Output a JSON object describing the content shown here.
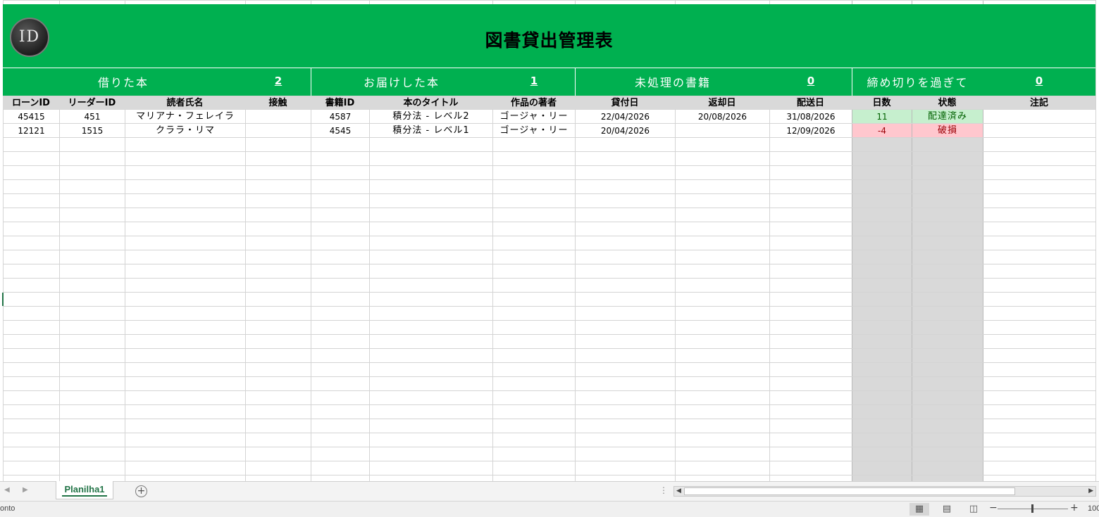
{
  "sheet": {
    "title": "図書貸出管理表",
    "logo_text": "ID",
    "stats": [
      {
        "label": "借りた本",
        "value": "2"
      },
      {
        "label": "お届けした本",
        "value": "1"
      },
      {
        "label": "未処理の書籍",
        "value": "0"
      },
      {
        "label": "締め切りを過ぎて",
        "value": "0"
      }
    ],
    "headers": [
      "ローンID",
      "リーダーID",
      "読者氏名",
      "接触",
      "書籍ID",
      "本のタイトル",
      "作品の著者",
      "貸付日",
      "返却日",
      "配送日",
      "日数",
      "状態",
      "注記"
    ],
    "rows": [
      {
        "loan_id": "45415",
        "reader_id": "451",
        "reader_name": "マリアナ・フェレイラ",
        "contact": "",
        "book_id": "4587",
        "book_title": "積分法 - レベル2",
        "author": "ゴージャ・リー",
        "loan_date": "22/04/2026",
        "return_date": "20/08/2026",
        "delivery_date": "31/08/2026",
        "days": "11",
        "status": "配達済み",
        "notes": "",
        "status_color": "#c6efce"
      },
      {
        "loan_id": "12121",
        "reader_id": "1515",
        "reader_name": "クララ・リマ",
        "contact": "",
        "book_id": "4545",
        "book_title": "積分法 - レベル1",
        "author": "ゴージャ・リー",
        "loan_date": "20/04/2026",
        "return_date": "",
        "delivery_date": "12/09/2026",
        "days": "-4",
        "status": "破損",
        "notes": "",
        "status_color": "#ffc7ce"
      }
    ]
  },
  "tabs": {
    "active_sheet": "Planilha1",
    "add_sheet_symbol": "+"
  },
  "status_bar": {
    "status_text": "onto",
    "zoom_level": "100"
  },
  "colors": {
    "header_green": "#00b050",
    "excel_accent": "#217346",
    "header_gray": "#d9d9d9",
    "good_fill": "#c6efce",
    "bad_fill": "#ffc7ce"
  }
}
